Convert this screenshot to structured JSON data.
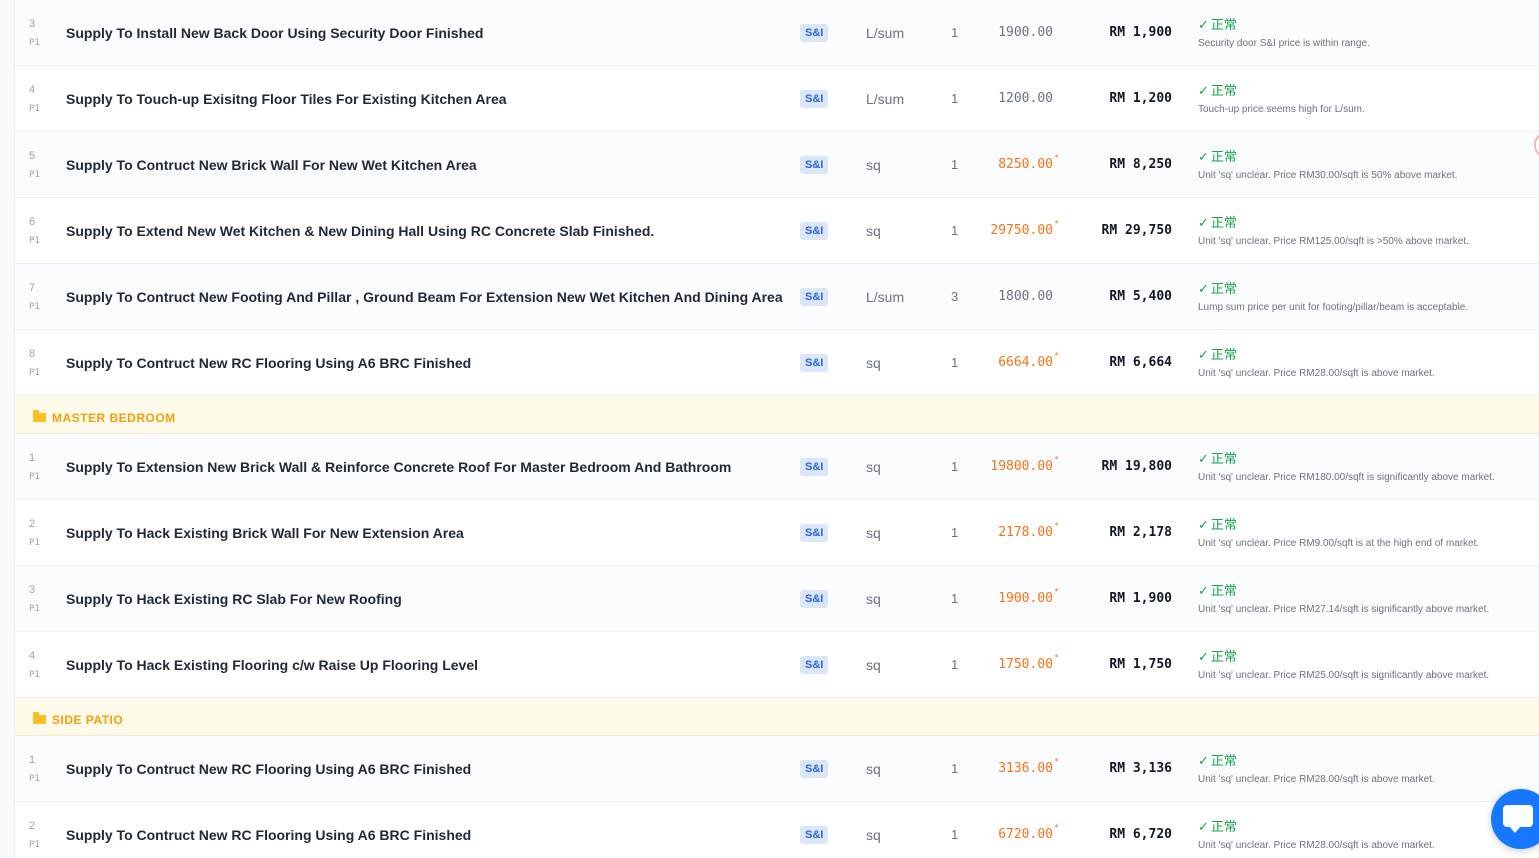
{
  "colors": {
    "accent": "#2563eb",
    "status_ok": "#16a34a",
    "rate_flag": "#f97316",
    "section": "#f59e0b",
    "fab": "#1677ff"
  },
  "rows_top": [
    {
      "idx": "3",
      "page": "P1",
      "desc": "Supply To Install New Back Door Using Security Door Finished",
      "tag": "S&I",
      "unit": "L/sum",
      "qty": "1",
      "rate": "1900.00",
      "flag": false,
      "total": "RM 1,900",
      "status": "正常",
      "note": "Security door S&I price is within range."
    },
    {
      "idx": "4",
      "page": "P1",
      "desc": "Supply To Touch-up Exisitng Floor Tiles For Existing Kitchen Area",
      "tag": "S&I",
      "unit": "L/sum",
      "qty": "1",
      "rate": "1200.00",
      "flag": false,
      "total": "RM 1,200",
      "status": "正常",
      "note": "Touch-up price seems high for L/sum."
    },
    {
      "idx": "5",
      "page": "P1",
      "desc": "Supply To Contruct New Brick Wall For New Wet Kitchen Area",
      "tag": "S&I",
      "unit": "sq",
      "qty": "1",
      "rate": "8250.00",
      "flag": true,
      "total": "RM 8,250",
      "status": "正常",
      "note": "Unit 'sq' unclear. Price RM30.00/sqft is 50% above market."
    },
    {
      "idx": "6",
      "page": "P1",
      "desc": "Supply To Extend New Wet Kitchen & New Dining Hall Using RC Concrete Slab Finished.",
      "tag": "S&I",
      "unit": "sq",
      "qty": "1",
      "rate": "29750.00",
      "flag": true,
      "total": "RM 29,750",
      "status": "正常",
      "note": "Unit 'sq' unclear. Price RM125.00/sqft is >50% above market."
    },
    {
      "idx": "7",
      "page": "P1",
      "desc": "Supply To Contruct New Footing And Pillar , Ground Beam For Extension New Wet Kitchen And Dining Area",
      "tag": "S&I",
      "unit": "L/sum",
      "qty": "3",
      "rate": "1800.00",
      "flag": false,
      "total": "RM 5,400",
      "status": "正常",
      "note": "Lump sum price per unit for footing/pillar/beam is acceptable."
    },
    {
      "idx": "8",
      "page": "P1",
      "desc": "Supply To Contruct New RC Flooring Using A6 BRC Finished",
      "tag": "S&I",
      "unit": "sq",
      "qty": "1",
      "rate": "6664.00",
      "flag": true,
      "total": "RM 6,664",
      "status": "正常",
      "note": "Unit 'sq' unclear. Price RM28.00/sqft is above market."
    }
  ],
  "section_master": {
    "title": "MASTER BEDROOM"
  },
  "rows_master": [
    {
      "idx": "1",
      "page": "P1",
      "desc": "Supply To Extension New Brick Wall & Reinforce Concrete Roof For Master Bedroom And Bathroom",
      "tag": "S&I",
      "unit": "sq",
      "qty": "1",
      "rate": "19800.00",
      "flag": true,
      "total": "RM 19,800",
      "status": "正常",
      "note": "Unit 'sq' unclear. Price RM180.00/sqft is significantly above market."
    },
    {
      "idx": "2",
      "page": "P1",
      "desc": "Supply To Hack Existing Brick Wall For New Extension Area",
      "tag": "S&I",
      "unit": "sq",
      "qty": "1",
      "rate": "2178.00",
      "flag": true,
      "total": "RM 2,178",
      "status": "正常",
      "note": "Unit 'sq' unclear. Price RM9.00/sqft is at the high end of market."
    },
    {
      "idx": "3",
      "page": "P1",
      "desc": "Supply To Hack Existing RC Slab For New Roofing",
      "tag": "S&I",
      "unit": "sq",
      "qty": "1",
      "rate": "1900.00",
      "flag": true,
      "total": "RM 1,900",
      "status": "正常",
      "note": "Unit 'sq' unclear. Price RM27.14/sqft is significantly above market."
    },
    {
      "idx": "4",
      "page": "P1",
      "desc": "Supply To Hack Existing Flooring c/w Raise Up Flooring Level",
      "tag": "S&I",
      "unit": "sq",
      "qty": "1",
      "rate": "1750.00",
      "flag": true,
      "total": "RM 1,750",
      "status": "正常",
      "note": "Unit 'sq' unclear. Price RM25.00/sqft is significantly above market."
    }
  ],
  "section_patio": {
    "title": "SIDE PATIO"
  },
  "rows_patio": [
    {
      "idx": "1",
      "page": "P1",
      "desc": "Supply To Contruct New RC Flooring Using A6 BRC Finished",
      "tag": "S&I",
      "unit": "sq",
      "qty": "1",
      "rate": "3136.00",
      "flag": true,
      "total": "RM 3,136",
      "status": "正常",
      "note": "Unit 'sq' unclear. Price RM28.00/sqft is above market."
    },
    {
      "idx": "2",
      "page": "P1",
      "desc": "Supply To Contruct New RC Flooring Using A6 BRC Finished",
      "tag": "S&I",
      "unit": "sq",
      "qty": "1",
      "rate": "6720.00",
      "flag": true,
      "total": "RM 6,720",
      "status": "正常",
      "note": "Unit 'sq' unclear. Price RM28.00/sqft is above market."
    }
  ],
  "icons": {
    "check": "check-icon",
    "folder": "folder-icon",
    "chat": "chat-icon"
  }
}
